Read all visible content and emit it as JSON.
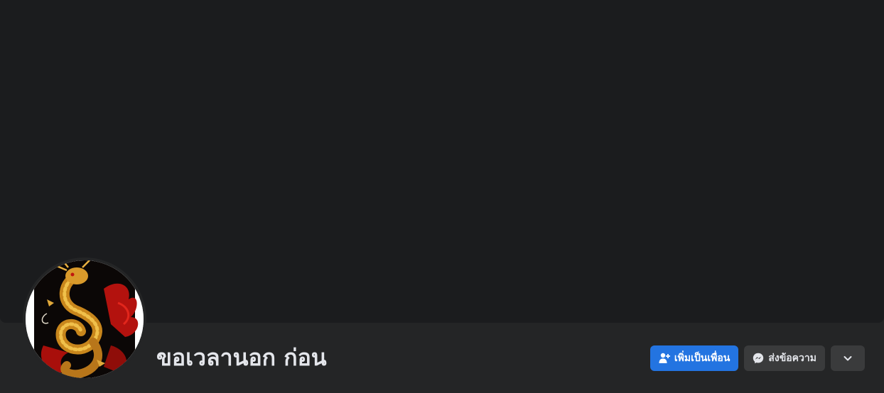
{
  "profile": {
    "name": "ขอเวลานอก ก่อน",
    "avatar_description_icon": "dragon-avatar-icon"
  },
  "actions": {
    "add_friend_label": "เพิ่มเป็นเพื่อน",
    "add_friend_icon": "add-friend-icon",
    "message_label": "ส่งข้อความ",
    "message_icon": "messenger-icon",
    "more_icon": "chevron-down-icon"
  },
  "colors": {
    "background": "#242526",
    "cover": "#1b1c1e",
    "primary_button": "#2374e1",
    "secondary_button": "#3a3b3c",
    "text": "#e4e6eb"
  }
}
